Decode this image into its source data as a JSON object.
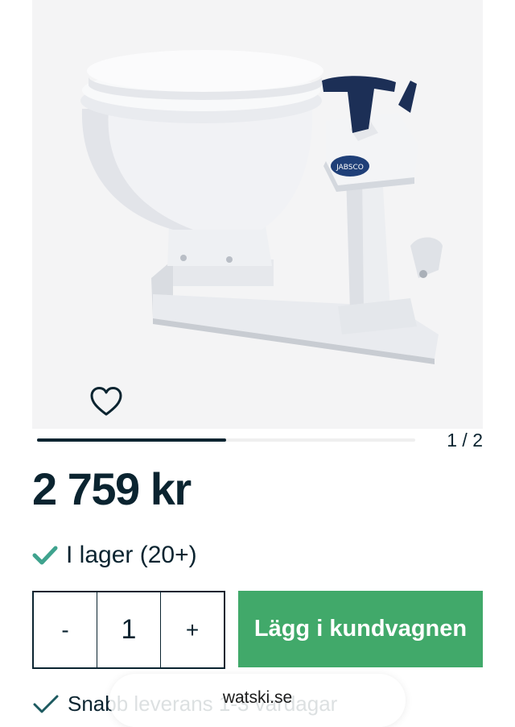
{
  "gallery": {
    "image_alt": "product-photo-marine-toilet",
    "favorite_icon": "heart-outline-icon",
    "counter": "1 / 2",
    "progress": 0.5
  },
  "product": {
    "price": "2 759 kr",
    "stock_icon": "check-icon",
    "stock_label": "I lager (20+)"
  },
  "purchase": {
    "decrement_label": "-",
    "quantity": "1",
    "increment_label": "+",
    "add_to_cart_label": "Lägg i kundvagnen"
  },
  "usp": {
    "icon": "check-icon",
    "label": "Snabb leverans 1-3 vardagar"
  },
  "browser": {
    "domain": "watski.se"
  },
  "colors": {
    "primary_text": "#0b2430",
    "accent_green": "#41a96a",
    "check_teal": "#3fa38e"
  }
}
